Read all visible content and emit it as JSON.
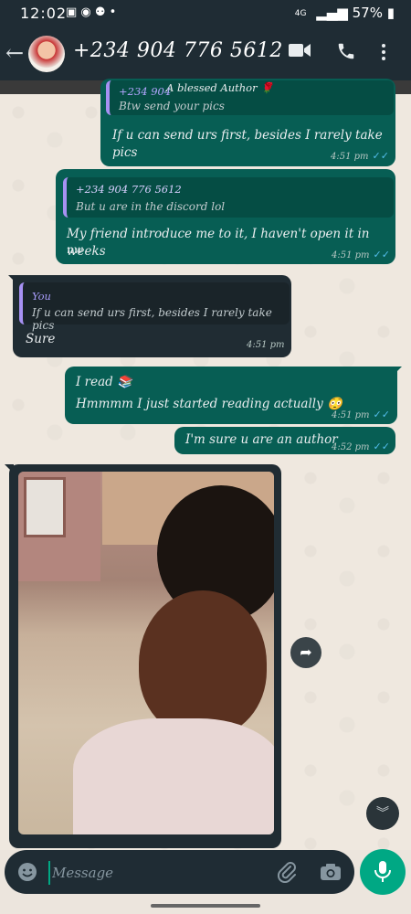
{
  "status_bar": {
    "time": "12:02",
    "left_icons": "▣ ◉ ⚉ •",
    "network": "4G",
    "signal": "▂▄▆",
    "battery": "57%"
  },
  "header": {
    "contact_name": "+234 904 776 5612"
  },
  "messages": {
    "m1": {
      "quote_author": "+234 904",
      "quote_overlay": "A blessed Author 🌹",
      "quote_text": "Btw send your pics",
      "text": "If u can send urs first, besides I rarely take pics",
      "time": "4:51 pm",
      "ticks": "✓✓"
    },
    "m2": {
      "quote_author": "+234 904 776 5612",
      "quote_text": "But u are in the discord lol",
      "text_line1": "My friend introduce me to it, I haven't open it in weeks",
      "text_line2": "nw",
      "time": "4:51 pm",
      "ticks": "✓✓"
    },
    "m3": {
      "quote_author": "You",
      "quote_text": "If u can send urs first, besides I rarely take pics",
      "text": "Sure",
      "time": "4:51 pm"
    },
    "m4": {
      "text_line1": "I read 📚",
      "text_line2": "Hmmmm I just started reading actually 😳",
      "time": "4:51 pm",
      "ticks": "✓✓"
    },
    "m5": {
      "text": "I'm sure u are an author",
      "time": "4:52 pm",
      "ticks": "✓✓"
    }
  },
  "composer": {
    "placeholder": "Message"
  },
  "colors": {
    "outgoing_bubble": "#075e54",
    "incoming_bubble": "#202c33",
    "accent": "#00a884",
    "read_ticks": "#53bdeb"
  },
  "icons": {
    "back": "back-arrow-icon",
    "video": "video-camera-icon",
    "call": "phone-icon",
    "menu": "more-vertical-icon",
    "forward": "forward-icon",
    "scroll_down": "chevrons-down-icon",
    "emoji": "emoji-icon",
    "attach": "paperclip-icon",
    "camera": "camera-icon",
    "mic": "microphone-icon"
  }
}
